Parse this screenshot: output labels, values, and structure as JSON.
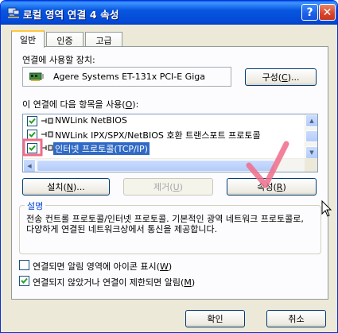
{
  "window": {
    "title": "로컬 영역 연결 4 속성",
    "help_label": "?",
    "close_label": "✕"
  },
  "tabs": [
    {
      "label": "일반",
      "active": true
    },
    {
      "label": "인증",
      "active": false
    },
    {
      "label": "고급",
      "active": false
    }
  ],
  "connect_using": {
    "label_pre": "연결에 사용할 장치:",
    "device": "Agere Systems ET-131x PCI-E Giga",
    "device_icon": "network-card-icon",
    "configure_pre": "구성(",
    "configure_key": "C",
    "configure_post": ")..."
  },
  "items": {
    "label_pre": "이 연결에 다음 항목을 사용(",
    "label_key": "O",
    "label_post": "):",
    "list": [
      {
        "label": "NWLink NetBIOS",
        "checked": true,
        "icon": "protocol-icon",
        "selected": false
      },
      {
        "label": "NWLink IPX/SPX/NetBIOS 호환 트랜스포트 프로토콜",
        "checked": true,
        "icon": "protocol-icon",
        "selected": false
      },
      {
        "label": "인터넷 프로토콜(TCP/IP)",
        "checked": true,
        "icon": "protocol-icon",
        "selected": true
      }
    ]
  },
  "buttons": {
    "install_pre": "설치(",
    "install_key": "N",
    "install_post": ")...",
    "uninstall_pre": "제거(",
    "uninstall_key": "U",
    "uninstall_post": ")",
    "properties_pre": "속성(",
    "properties_key": "R",
    "properties_post": ")",
    "ok": "확인",
    "cancel": "취소"
  },
  "description": {
    "title": "설명",
    "text": "전송 컨트롤 프로토콜/인터넷 프로토콜. 기본적인 광역 네트워크 프로토콜로, 다양하게 연결된 네트워크상에서 통신을 제공합니다."
  },
  "options": {
    "show_icon_pre": "연결되면 알림 영역에 아이콘 표시(",
    "show_icon_key": "W",
    "show_icon_post": ")",
    "show_icon_checked": false,
    "notify_pre": "연결되지 않았거나 연결이 제한되면 알림(",
    "notify_key": "M",
    "notify_post": ")",
    "notify_checked": true
  },
  "colors": {
    "title_bar": "#0055e5",
    "selection": "#316ac5",
    "annotation": "#f06c8a",
    "group_title": "#0046d5"
  }
}
